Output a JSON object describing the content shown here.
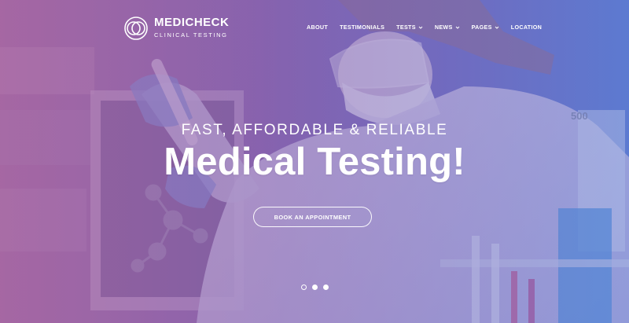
{
  "brand": {
    "name": "MEDICHECK",
    "tagline": "CLINICAL TESTING"
  },
  "nav": {
    "items": [
      {
        "label": "ABOUT",
        "has_dropdown": false
      },
      {
        "label": "TESTIMONIALS",
        "has_dropdown": false
      },
      {
        "label": "TESTS",
        "has_dropdown": true
      },
      {
        "label": "NEWS",
        "has_dropdown": true
      },
      {
        "label": "PAGES",
        "has_dropdown": true
      },
      {
        "label": "LOCATION",
        "has_dropdown": false
      }
    ]
  },
  "hero": {
    "kicker": "FAST, AFFORDABLE & RELIABLE",
    "headline": "Medical Testing!",
    "cta_label": "BOOK AN APPOINTMENT",
    "beaker_marking": "500",
    "slides": {
      "count": 3,
      "active": 1
    }
  },
  "colors": {
    "overlay_left": "#a06ba6",
    "overlay_mid": "#8a65ad",
    "overlay_right": "#5b7bd0",
    "text": "#ffffff"
  }
}
